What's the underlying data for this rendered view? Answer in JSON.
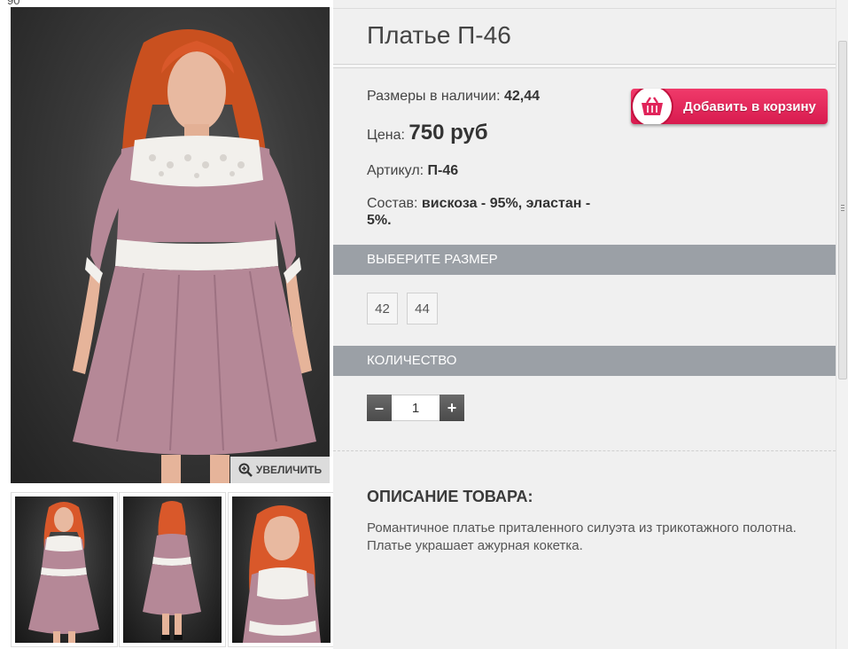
{
  "header_fragment": "90",
  "product": {
    "title": "Платье П-46",
    "sizes_label": "Размеры в наличии:",
    "sizes_value": "42,44",
    "price_label": "Цена:",
    "price_value": "750 руб",
    "sku_label": "Артикул:",
    "sku_value": "П-46",
    "composition_label": "Состав:",
    "composition_value_line1": "вискоза - 95%, эластан -",
    "composition_value_line2": "5%."
  },
  "cart_button": {
    "label": "Добавить в корзину",
    "icon": "basket-icon"
  },
  "zoom_button": {
    "label": "УВЕЛИЧИТЬ",
    "icon": "zoom-in-icon"
  },
  "size_section": {
    "header": "ВЫБЕРИТЕ РАЗМЕР",
    "options": [
      "42",
      "44"
    ]
  },
  "quantity_section": {
    "header": "КОЛИЧЕСТВО",
    "minus": "–",
    "plus": "+",
    "value": "1"
  },
  "description": {
    "title": "ОПИСАНИЕ ТОВАРА:",
    "text": "Романтичное платье приталенного силуэта из трикотажного полотна. Платье украшает ажурная кокетка."
  },
  "colors": {
    "dress": "#b58897",
    "dress_dark": "#8f6573",
    "lace": "#f2f0ec",
    "hair": "#d9582a",
    "section_header": "#9ba0a6",
    "cart_button": "#e0245a"
  }
}
